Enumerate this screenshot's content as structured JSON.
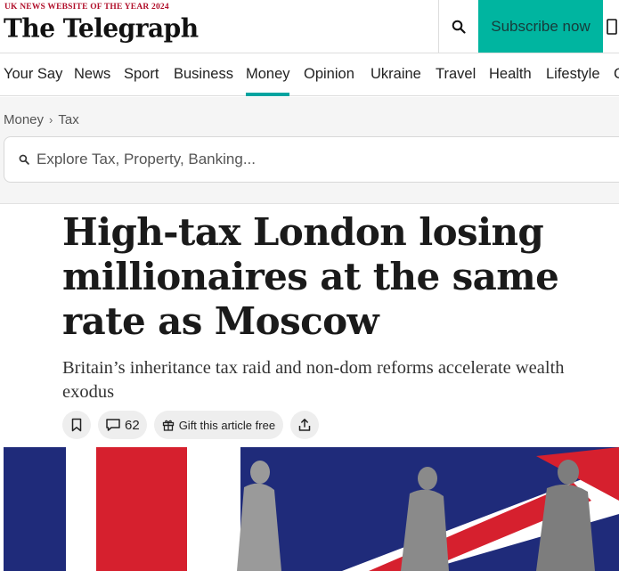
{
  "header": {
    "award": "UK NEWS WEBSITE OF THE YEAR 2024",
    "logo": "The Telegraph",
    "search_icon": "search-icon",
    "subscribe_label": "Subscribe now",
    "account_icon": "account-icon"
  },
  "nav": {
    "items": [
      "Your Say",
      "News",
      "Sport",
      "Business",
      "Money",
      "Opinion",
      "Ukraine",
      "Travel",
      "Health",
      "Lifestyle",
      "C"
    ],
    "active": "Money"
  },
  "breadcrumb": {
    "items": [
      "Money",
      "Tax"
    ]
  },
  "explore": {
    "placeholder": "Explore Tax, Property, Banking..."
  },
  "article": {
    "headline": "High-tax London losing millionaires at the same rate as Moscow",
    "standfirst": "Britain’s inheritance tax raid and non-dom reforms accelerate wealth exodus",
    "comments_count": "62",
    "gift_label": "Gift this article free",
    "bookmark_icon": "bookmark-icon",
    "comment_icon": "comment-icon",
    "gift_icon": "gift-icon",
    "share_icon": "share-icon"
  },
  "colors": {
    "brand_accent": "#00b5a0",
    "nav_underline": "#00a4a0",
    "award_red": "#b1102b",
    "flag_blue": "#1f2b7a",
    "flag_red": "#d6202e"
  }
}
